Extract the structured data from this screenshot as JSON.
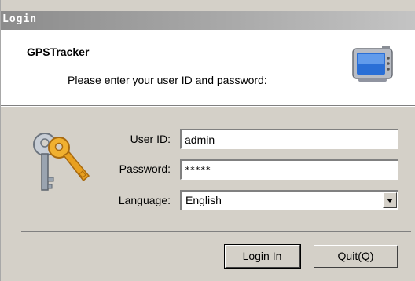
{
  "window": {
    "title": "Login"
  },
  "header": {
    "app_name": "GPSTracker",
    "prompt": "Please enter your user ID and password:",
    "icon": "gps-device-icon"
  },
  "form": {
    "icon": "keys-icon",
    "user_id_label": "User ID:",
    "user_id_value": "admin",
    "password_label": "Password:",
    "password_value": "*****",
    "language_label": "Language:",
    "language_value": "English"
  },
  "buttons": {
    "login": "Login In",
    "quit": "Quit(Q)"
  },
  "colors": {
    "dialog_bg": "#d4d0c8",
    "header_bg": "#ffffff",
    "titlebar": "#8c8c8c",
    "key_gold": "#e8a020",
    "key_silver": "#9aa4b0",
    "device_blue": "#2a6fd6"
  }
}
